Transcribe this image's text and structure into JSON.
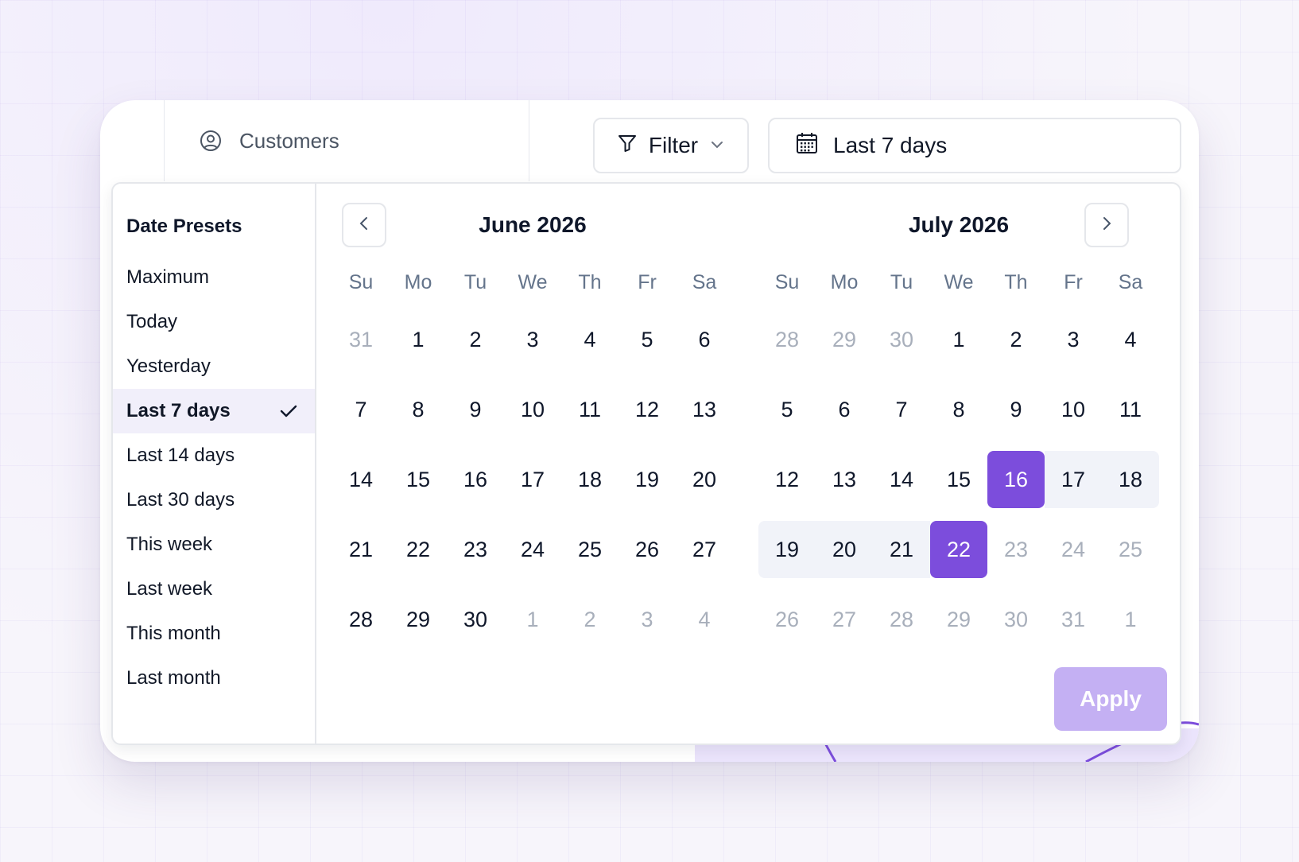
{
  "header": {
    "tab_label": "Customers",
    "tab_icon": "user-circle-icon",
    "filter_label": "Filter",
    "range_label": "Last 7 days"
  },
  "presets": {
    "title": "Date Presets",
    "items": [
      {
        "label": "Maximum",
        "active": false
      },
      {
        "label": "Today",
        "active": false
      },
      {
        "label": "Yesterday",
        "active": false
      },
      {
        "label": "Last 7 days",
        "active": true
      },
      {
        "label": "Last 14 days",
        "active": false
      },
      {
        "label": "Last 30 days",
        "active": false
      },
      {
        "label": "This week",
        "active": false
      },
      {
        "label": "Last week",
        "active": false
      },
      {
        "label": "This month",
        "active": false
      },
      {
        "label": "Last month",
        "active": false
      }
    ]
  },
  "weekdays": [
    "Su",
    "Mo",
    "Tu",
    "We",
    "Th",
    "Fr",
    "Sa"
  ],
  "months": [
    {
      "title": "June 2026",
      "weeks": [
        [
          {
            "d": "31",
            "muted": true
          },
          {
            "d": "1"
          },
          {
            "d": "2"
          },
          {
            "d": "3"
          },
          {
            "d": "4"
          },
          {
            "d": "5"
          },
          {
            "d": "6"
          }
        ],
        [
          {
            "d": "7"
          },
          {
            "d": "8"
          },
          {
            "d": "9"
          },
          {
            "d": "10"
          },
          {
            "d": "11"
          },
          {
            "d": "12"
          },
          {
            "d": "13"
          }
        ],
        [
          {
            "d": "14"
          },
          {
            "d": "15"
          },
          {
            "d": "16"
          },
          {
            "d": "17"
          },
          {
            "d": "18"
          },
          {
            "d": "19"
          },
          {
            "d": "20"
          }
        ],
        [
          {
            "d": "21"
          },
          {
            "d": "22"
          },
          {
            "d": "23"
          },
          {
            "d": "24"
          },
          {
            "d": "25"
          },
          {
            "d": "26"
          },
          {
            "d": "27"
          }
        ],
        [
          {
            "d": "28"
          },
          {
            "d": "29"
          },
          {
            "d": "30"
          },
          {
            "d": "1",
            "muted": true
          },
          {
            "d": "2",
            "muted": true
          },
          {
            "d": "3",
            "muted": true
          },
          {
            "d": "4",
            "muted": true
          }
        ]
      ]
    },
    {
      "title": "July 2026",
      "weeks": [
        [
          {
            "d": "28",
            "muted": true
          },
          {
            "d": "29",
            "muted": true
          },
          {
            "d": "30",
            "muted": true
          },
          {
            "d": "1"
          },
          {
            "d": "2"
          },
          {
            "d": "3"
          },
          {
            "d": "4"
          }
        ],
        [
          {
            "d": "5"
          },
          {
            "d": "6"
          },
          {
            "d": "7"
          },
          {
            "d": "8"
          },
          {
            "d": "9"
          },
          {
            "d": "10"
          },
          {
            "d": "11"
          }
        ],
        [
          {
            "d": "12"
          },
          {
            "d": "13"
          },
          {
            "d": "14"
          },
          {
            "d": "15"
          },
          {
            "d": "16",
            "selected": true
          },
          {
            "d": "17",
            "range": true
          },
          {
            "d": "18",
            "range": true,
            "row_end": true
          }
        ],
        [
          {
            "d": "19",
            "range": true,
            "row_start": true
          },
          {
            "d": "20",
            "range": true
          },
          {
            "d": "21",
            "range": true
          },
          {
            "d": "22",
            "selected": true
          },
          {
            "d": "23",
            "muted": true
          },
          {
            "d": "24",
            "muted": true
          },
          {
            "d": "25",
            "muted": true
          }
        ],
        [
          {
            "d": "26",
            "muted": true
          },
          {
            "d": "27",
            "muted": true
          },
          {
            "d": "28",
            "muted": true
          },
          {
            "d": "29",
            "muted": true
          },
          {
            "d": "30",
            "muted": true
          },
          {
            "d": "31",
            "muted": true
          },
          {
            "d": "1",
            "muted": true
          }
        ]
      ]
    }
  ],
  "apply_label": "Apply",
  "colors": {
    "accent": "#7c4ddc",
    "range_bg": "#f1f3f9",
    "apply_disabled": "#c4b0f3",
    "preset_active_bg": "#f1effa"
  }
}
